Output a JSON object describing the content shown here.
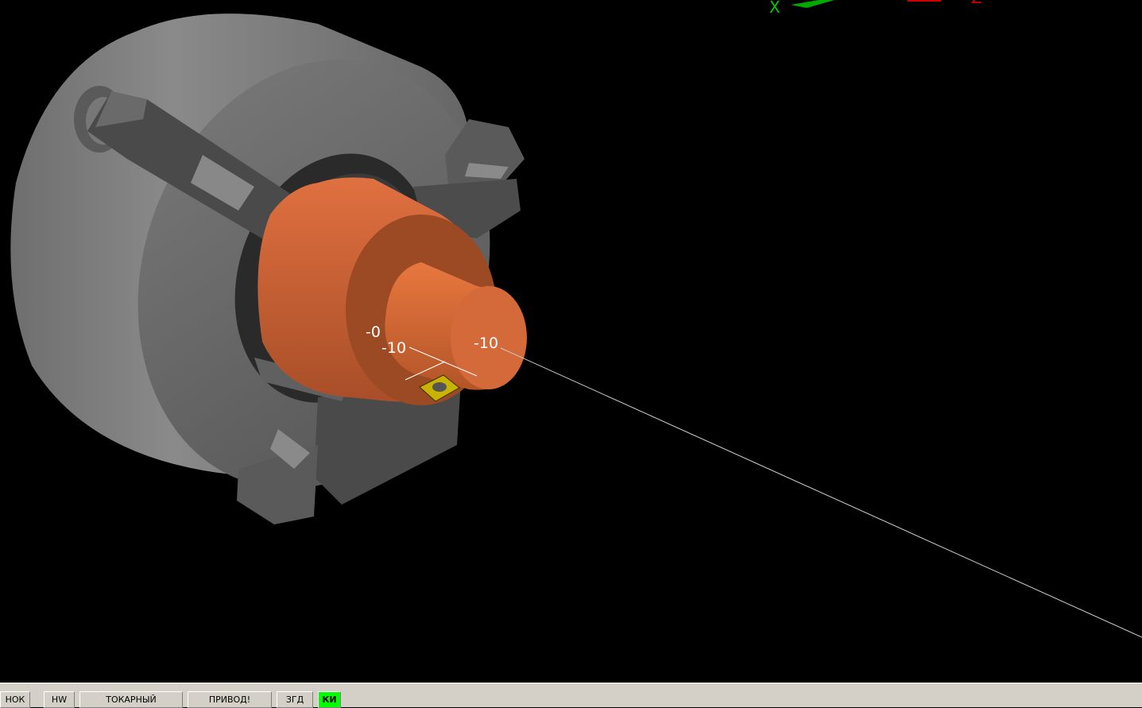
{
  "viewport": {
    "labels": {
      "left_cut": "-0",
      "mid": "-10",
      "face": "-10"
    },
    "axis_triad": {
      "x_label": "X",
      "z_label": "Z",
      "x_color": "#00cc00",
      "z_color": "#cc0000"
    },
    "colors": {
      "chuck": "#808080",
      "workpiece": "#d96b3a",
      "insert": "#c8b400",
      "background": "#000000"
    }
  },
  "statusbar": {
    "buttons": [
      {
        "label": "НОК",
        "active": false
      },
      {
        "label": "HW",
        "active": false
      },
      {
        "label": "ТОКАРНЫЙ",
        "active": false
      },
      {
        "label": "ПРИВОД!",
        "active": false
      },
      {
        "label": "ЗГД",
        "active": false
      },
      {
        "label": "КИ",
        "active": true
      }
    ]
  }
}
